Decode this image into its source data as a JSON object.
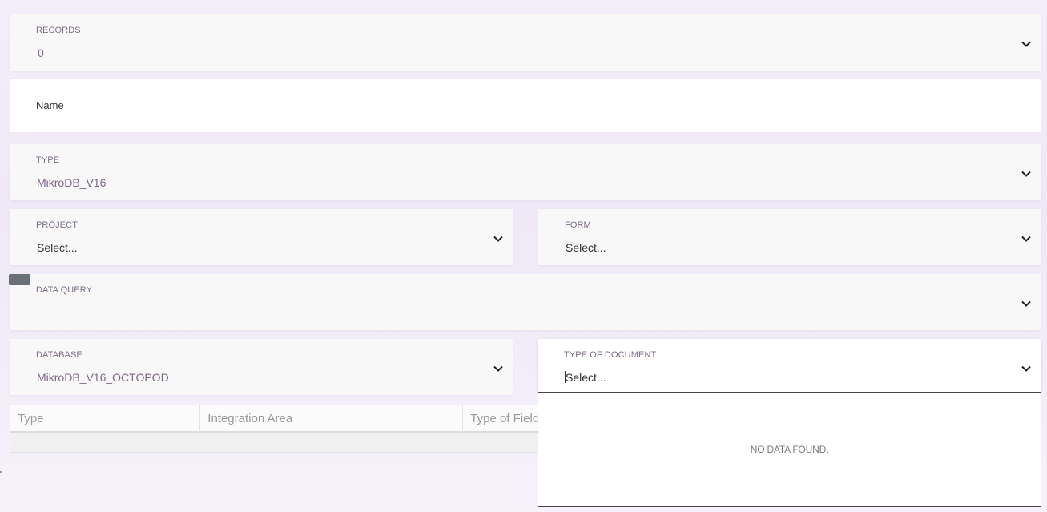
{
  "records": {
    "label": "RECORDS",
    "value": "0"
  },
  "name": {
    "label": "Name"
  },
  "type": {
    "label": "TYPE",
    "value": "MikroDB_V16"
  },
  "project": {
    "label": "PROJECT",
    "value": "Select..."
  },
  "form": {
    "label": "FORM",
    "value": "Select..."
  },
  "data_query": {
    "label": "DATA QUERY",
    "value": ""
  },
  "database": {
    "label": "DATABASE",
    "value": "MikroDB_V16_OCTOPOD"
  },
  "type_of_document": {
    "label": "TYPE OF DOCUMENT",
    "value": "Select...",
    "empty_message": "NO DATA FOUND."
  },
  "table": {
    "columns": [
      "Type",
      "Integration Area",
      "Type of Field"
    ]
  },
  "icons": {
    "dropdown": "chevron-down-icon"
  },
  "colors": {
    "label": "#7d6d86",
    "value": "#7d6888",
    "background": "#f3eef9"
  }
}
